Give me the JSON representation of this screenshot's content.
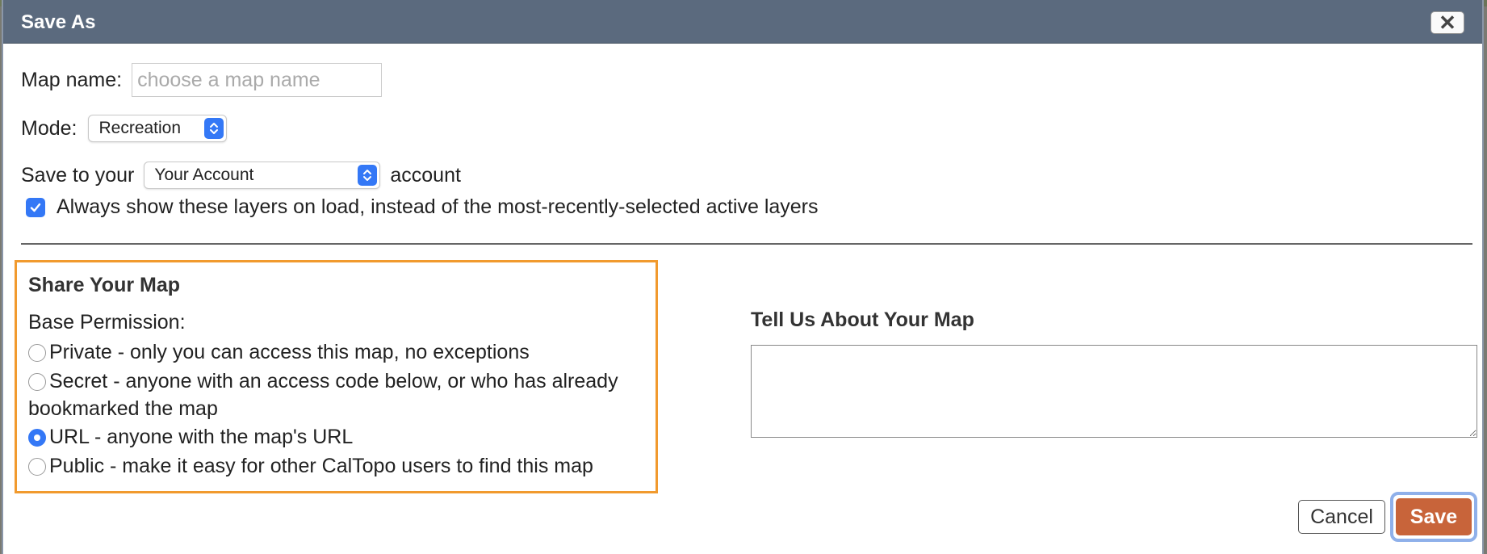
{
  "dialog": {
    "title": "Save As",
    "close_glyph": "✕"
  },
  "map_name": {
    "label": "Map name:",
    "value": "",
    "placeholder": "choose a map name"
  },
  "mode": {
    "label": "Mode:",
    "selected": "Recreation"
  },
  "save_to": {
    "prefix": "Save to your",
    "selected": "Your Account",
    "suffix": "account"
  },
  "always_show_layers": {
    "checked": true,
    "label": "Always show these layers on load, instead of the most-recently-selected active layers"
  },
  "share": {
    "heading": "Share Your Map",
    "permission_label": "Base Permission:",
    "options": [
      {
        "label": "Private - only you can access this map, no exceptions",
        "checked": false
      },
      {
        "label": "Secret - anyone with an access code below, or who has already bookmarked the map",
        "checked": false
      },
      {
        "label": "URL - anyone with the map's URL",
        "checked": true
      },
      {
        "label": "Public - make it easy for other CalTopo users to find this map",
        "checked": false
      }
    ]
  },
  "about": {
    "heading": "Tell Us About Your Map",
    "value": ""
  },
  "buttons": {
    "cancel": "Cancel",
    "save": "Save"
  },
  "colors": {
    "titlebar": "#5b6a7e",
    "accent_blue": "#3478f6",
    "highlight_orange": "#f19a2e",
    "save_button": "#c8643a"
  }
}
